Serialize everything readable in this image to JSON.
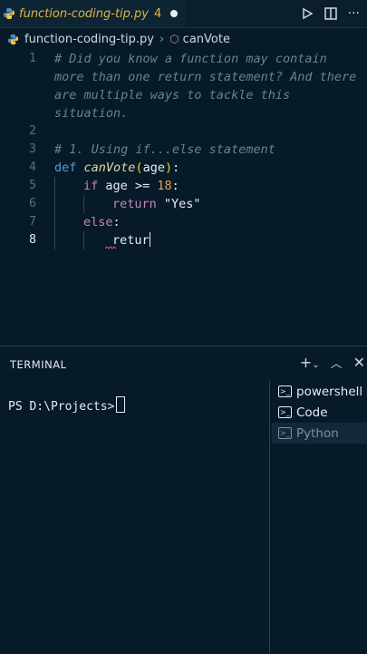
{
  "tab": {
    "filename": "function-coding-tip.py",
    "problems": "4",
    "icon": "python-icon"
  },
  "tab_actions": {
    "run": "run-icon",
    "split": "split-editor-icon",
    "more": "more-icon"
  },
  "breadcrumb": {
    "file": "function-coding-tip.py",
    "symbol": "canVote"
  },
  "editor": {
    "line_numbers": [
      "1",
      "2",
      "3",
      "4",
      "5",
      "6",
      "7",
      "8"
    ],
    "active_line": "8",
    "comment_lines": [
      "# Did you know a function may contain",
      "more than one return statement? And there",
      "are multiple ways to tackle this",
      "situation.",
      "# 1. Using if...else statement"
    ],
    "code": {
      "def_kw": "def",
      "fn_name": "canVote",
      "param": "age",
      "if_kw": "if",
      "if_var": "age",
      "op": ">=",
      "num": "18",
      "colon": ":",
      "return_kw": "return",
      "str_val": "\"Yes\"",
      "else_kw": "else",
      "typing": "retur"
    }
  },
  "panel": {
    "title": "TERMINAL",
    "prompt": "PS D:\\Projects>",
    "terminals": [
      "powershell",
      "Code",
      "Python"
    ],
    "selected_terminal": "Python"
  },
  "colors": {
    "background": "#071a27",
    "keyword": "#c586c0",
    "number": "#f0a05a",
    "function": "#dcdcaa"
  }
}
